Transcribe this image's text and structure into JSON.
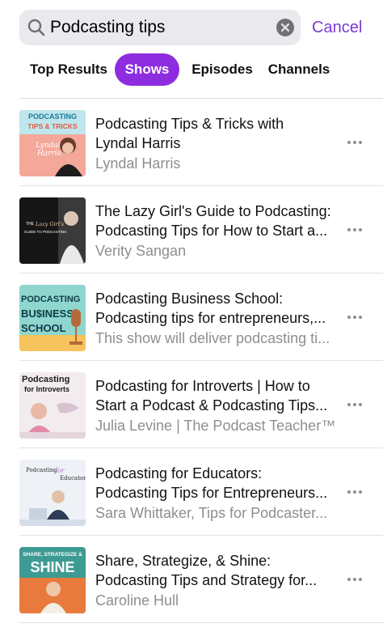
{
  "search": {
    "query": "Podcasting tips",
    "icon": "magnifying-glass-icon",
    "clear_icon": "clear-x-icon",
    "cancel_label": "Cancel"
  },
  "tabs": [
    {
      "label": "Top Results",
      "active": false
    },
    {
      "label": "Shows",
      "active": true
    },
    {
      "label": "Episodes",
      "active": false
    },
    {
      "label": "Channels",
      "active": false
    }
  ],
  "accent_color": "#8e2de0",
  "cancel_color": "#7a3bd7",
  "results": [
    {
      "title_line1": "Podcasting Tips & Tricks with",
      "title_line2": "Lyndal Harris",
      "subtitle": "Lyndal Harris",
      "artwork": {
        "text": [
          "PODCASTING",
          "TIPS & TRICKS",
          "Lyndal",
          "Harris"
        ]
      },
      "more_icon": "ellipsis-icon"
    },
    {
      "title_line1": "The Lazy Girl's Guide to Podcasting:",
      "title_line2": "Podcasting Tips for How to Start a...",
      "subtitle": "Verity Sangan",
      "artwork": {
        "text": [
          "THE",
          "Lazy Girl's",
          "GUIDE TO PODCASTING"
        ]
      },
      "more_icon": "ellipsis-icon"
    },
    {
      "title_line1": "Podcasting Business School:",
      "title_line2": "Podcasting tips for entrepreneurs,...",
      "subtitle": "This show will deliver podcasting ti...",
      "artwork": {
        "text": [
          "PODCASTING",
          "BU$INESS",
          "SCHOOL"
        ]
      },
      "more_icon": "ellipsis-icon"
    },
    {
      "title_line1": "Podcasting for Introverts | How to",
      "title_line2": "Start a Podcast & Podcasting Tips...",
      "subtitle": "Julia Levine | The Podcast Teacher™",
      "artwork": {
        "text": [
          "Podcasting",
          "for Introverts"
        ]
      },
      "more_icon": "ellipsis-icon"
    },
    {
      "title_line1": "Podcasting for Educators:",
      "title_line2": "Podcasting Tips for Entrepreneurs...",
      "subtitle": "Sara Whittaker, Tips for Podcaster...",
      "artwork": {
        "text": [
          "Podcasting",
          "for",
          "Educators"
        ]
      },
      "more_icon": "ellipsis-icon"
    },
    {
      "title_line1": "Share, Strategize, & Shine:",
      "title_line2": "Podcasting Tips and Strategy for...",
      "subtitle": "Caroline Hull",
      "artwork": {
        "text": [
          "SHARE, STRATEGIZE &",
          "SHINE"
        ]
      },
      "more_icon": "ellipsis-icon"
    }
  ]
}
